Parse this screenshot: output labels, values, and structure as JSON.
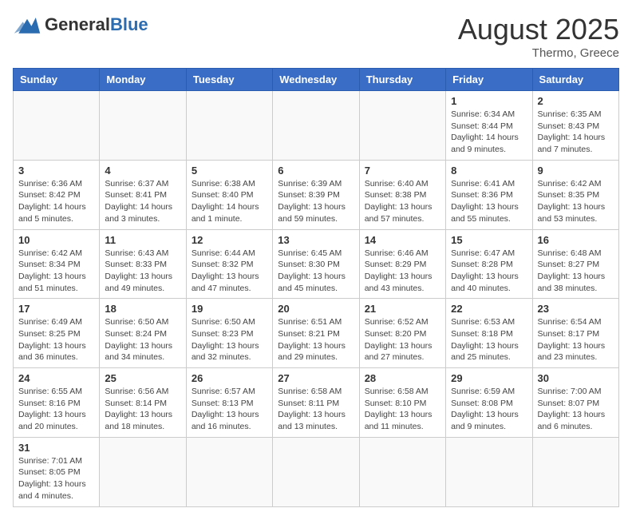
{
  "header": {
    "logo_general": "General",
    "logo_blue": "Blue",
    "month_year": "August 2025",
    "location": "Thermo, Greece"
  },
  "weekdays": [
    "Sunday",
    "Monday",
    "Tuesday",
    "Wednesday",
    "Thursday",
    "Friday",
    "Saturday"
  ],
  "weeks": [
    [
      {
        "day": "",
        "info": ""
      },
      {
        "day": "",
        "info": ""
      },
      {
        "day": "",
        "info": ""
      },
      {
        "day": "",
        "info": ""
      },
      {
        "day": "",
        "info": ""
      },
      {
        "day": "1",
        "info": "Sunrise: 6:34 AM\nSunset: 8:44 PM\nDaylight: 14 hours and 9 minutes."
      },
      {
        "day": "2",
        "info": "Sunrise: 6:35 AM\nSunset: 8:43 PM\nDaylight: 14 hours and 7 minutes."
      }
    ],
    [
      {
        "day": "3",
        "info": "Sunrise: 6:36 AM\nSunset: 8:42 PM\nDaylight: 14 hours and 5 minutes."
      },
      {
        "day": "4",
        "info": "Sunrise: 6:37 AM\nSunset: 8:41 PM\nDaylight: 14 hours and 3 minutes."
      },
      {
        "day": "5",
        "info": "Sunrise: 6:38 AM\nSunset: 8:40 PM\nDaylight: 14 hours and 1 minute."
      },
      {
        "day": "6",
        "info": "Sunrise: 6:39 AM\nSunset: 8:39 PM\nDaylight: 13 hours and 59 minutes."
      },
      {
        "day": "7",
        "info": "Sunrise: 6:40 AM\nSunset: 8:38 PM\nDaylight: 13 hours and 57 minutes."
      },
      {
        "day": "8",
        "info": "Sunrise: 6:41 AM\nSunset: 8:36 PM\nDaylight: 13 hours and 55 minutes."
      },
      {
        "day": "9",
        "info": "Sunrise: 6:42 AM\nSunset: 8:35 PM\nDaylight: 13 hours and 53 minutes."
      }
    ],
    [
      {
        "day": "10",
        "info": "Sunrise: 6:42 AM\nSunset: 8:34 PM\nDaylight: 13 hours and 51 minutes."
      },
      {
        "day": "11",
        "info": "Sunrise: 6:43 AM\nSunset: 8:33 PM\nDaylight: 13 hours and 49 minutes."
      },
      {
        "day": "12",
        "info": "Sunrise: 6:44 AM\nSunset: 8:32 PM\nDaylight: 13 hours and 47 minutes."
      },
      {
        "day": "13",
        "info": "Sunrise: 6:45 AM\nSunset: 8:30 PM\nDaylight: 13 hours and 45 minutes."
      },
      {
        "day": "14",
        "info": "Sunrise: 6:46 AM\nSunset: 8:29 PM\nDaylight: 13 hours and 43 minutes."
      },
      {
        "day": "15",
        "info": "Sunrise: 6:47 AM\nSunset: 8:28 PM\nDaylight: 13 hours and 40 minutes."
      },
      {
        "day": "16",
        "info": "Sunrise: 6:48 AM\nSunset: 8:27 PM\nDaylight: 13 hours and 38 minutes."
      }
    ],
    [
      {
        "day": "17",
        "info": "Sunrise: 6:49 AM\nSunset: 8:25 PM\nDaylight: 13 hours and 36 minutes."
      },
      {
        "day": "18",
        "info": "Sunrise: 6:50 AM\nSunset: 8:24 PM\nDaylight: 13 hours and 34 minutes."
      },
      {
        "day": "19",
        "info": "Sunrise: 6:50 AM\nSunset: 8:23 PM\nDaylight: 13 hours and 32 minutes."
      },
      {
        "day": "20",
        "info": "Sunrise: 6:51 AM\nSunset: 8:21 PM\nDaylight: 13 hours and 29 minutes."
      },
      {
        "day": "21",
        "info": "Sunrise: 6:52 AM\nSunset: 8:20 PM\nDaylight: 13 hours and 27 minutes."
      },
      {
        "day": "22",
        "info": "Sunrise: 6:53 AM\nSunset: 8:18 PM\nDaylight: 13 hours and 25 minutes."
      },
      {
        "day": "23",
        "info": "Sunrise: 6:54 AM\nSunset: 8:17 PM\nDaylight: 13 hours and 23 minutes."
      }
    ],
    [
      {
        "day": "24",
        "info": "Sunrise: 6:55 AM\nSunset: 8:16 PM\nDaylight: 13 hours and 20 minutes."
      },
      {
        "day": "25",
        "info": "Sunrise: 6:56 AM\nSunset: 8:14 PM\nDaylight: 13 hours and 18 minutes."
      },
      {
        "day": "26",
        "info": "Sunrise: 6:57 AM\nSunset: 8:13 PM\nDaylight: 13 hours and 16 minutes."
      },
      {
        "day": "27",
        "info": "Sunrise: 6:58 AM\nSunset: 8:11 PM\nDaylight: 13 hours and 13 minutes."
      },
      {
        "day": "28",
        "info": "Sunrise: 6:58 AM\nSunset: 8:10 PM\nDaylight: 13 hours and 11 minutes."
      },
      {
        "day": "29",
        "info": "Sunrise: 6:59 AM\nSunset: 8:08 PM\nDaylight: 13 hours and 9 minutes."
      },
      {
        "day": "30",
        "info": "Sunrise: 7:00 AM\nSunset: 8:07 PM\nDaylight: 13 hours and 6 minutes."
      }
    ],
    [
      {
        "day": "31",
        "info": "Sunrise: 7:01 AM\nSunset: 8:05 PM\nDaylight: 13 hours and 4 minutes."
      },
      {
        "day": "",
        "info": ""
      },
      {
        "day": "",
        "info": ""
      },
      {
        "day": "",
        "info": ""
      },
      {
        "day": "",
        "info": ""
      },
      {
        "day": "",
        "info": ""
      },
      {
        "day": "",
        "info": ""
      }
    ]
  ]
}
